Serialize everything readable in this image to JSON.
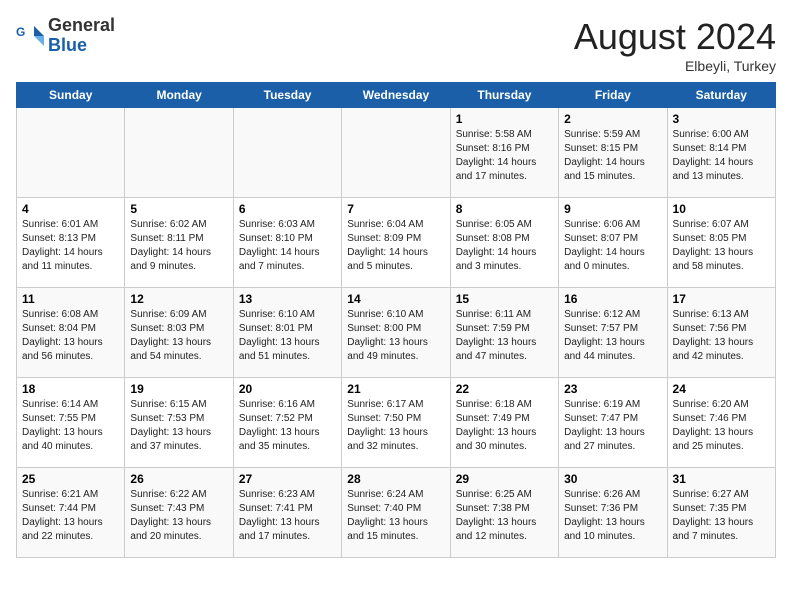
{
  "header": {
    "logo_line1": "General",
    "logo_line2": "Blue",
    "month_title": "August 2024",
    "location": "Elbeyli, Turkey"
  },
  "weekdays": [
    "Sunday",
    "Monday",
    "Tuesday",
    "Wednesday",
    "Thursday",
    "Friday",
    "Saturday"
  ],
  "weeks": [
    [
      {
        "day": "",
        "info": ""
      },
      {
        "day": "",
        "info": ""
      },
      {
        "day": "",
        "info": ""
      },
      {
        "day": "",
        "info": ""
      },
      {
        "day": "1",
        "info": "Sunrise: 5:58 AM\nSunset: 8:16 PM\nDaylight: 14 hours\nand 17 minutes."
      },
      {
        "day": "2",
        "info": "Sunrise: 5:59 AM\nSunset: 8:15 PM\nDaylight: 14 hours\nand 15 minutes."
      },
      {
        "day": "3",
        "info": "Sunrise: 6:00 AM\nSunset: 8:14 PM\nDaylight: 14 hours\nand 13 minutes."
      }
    ],
    [
      {
        "day": "4",
        "info": "Sunrise: 6:01 AM\nSunset: 8:13 PM\nDaylight: 14 hours\nand 11 minutes."
      },
      {
        "day": "5",
        "info": "Sunrise: 6:02 AM\nSunset: 8:11 PM\nDaylight: 14 hours\nand 9 minutes."
      },
      {
        "day": "6",
        "info": "Sunrise: 6:03 AM\nSunset: 8:10 PM\nDaylight: 14 hours\nand 7 minutes."
      },
      {
        "day": "7",
        "info": "Sunrise: 6:04 AM\nSunset: 8:09 PM\nDaylight: 14 hours\nand 5 minutes."
      },
      {
        "day": "8",
        "info": "Sunrise: 6:05 AM\nSunset: 8:08 PM\nDaylight: 14 hours\nand 3 minutes."
      },
      {
        "day": "9",
        "info": "Sunrise: 6:06 AM\nSunset: 8:07 PM\nDaylight: 14 hours\nand 0 minutes."
      },
      {
        "day": "10",
        "info": "Sunrise: 6:07 AM\nSunset: 8:05 PM\nDaylight: 13 hours\nand 58 minutes."
      }
    ],
    [
      {
        "day": "11",
        "info": "Sunrise: 6:08 AM\nSunset: 8:04 PM\nDaylight: 13 hours\nand 56 minutes."
      },
      {
        "day": "12",
        "info": "Sunrise: 6:09 AM\nSunset: 8:03 PM\nDaylight: 13 hours\nand 54 minutes."
      },
      {
        "day": "13",
        "info": "Sunrise: 6:10 AM\nSunset: 8:01 PM\nDaylight: 13 hours\nand 51 minutes."
      },
      {
        "day": "14",
        "info": "Sunrise: 6:10 AM\nSunset: 8:00 PM\nDaylight: 13 hours\nand 49 minutes."
      },
      {
        "day": "15",
        "info": "Sunrise: 6:11 AM\nSunset: 7:59 PM\nDaylight: 13 hours\nand 47 minutes."
      },
      {
        "day": "16",
        "info": "Sunrise: 6:12 AM\nSunset: 7:57 PM\nDaylight: 13 hours\nand 44 minutes."
      },
      {
        "day": "17",
        "info": "Sunrise: 6:13 AM\nSunset: 7:56 PM\nDaylight: 13 hours\nand 42 minutes."
      }
    ],
    [
      {
        "day": "18",
        "info": "Sunrise: 6:14 AM\nSunset: 7:55 PM\nDaylight: 13 hours\nand 40 minutes."
      },
      {
        "day": "19",
        "info": "Sunrise: 6:15 AM\nSunset: 7:53 PM\nDaylight: 13 hours\nand 37 minutes."
      },
      {
        "day": "20",
        "info": "Sunrise: 6:16 AM\nSunset: 7:52 PM\nDaylight: 13 hours\nand 35 minutes."
      },
      {
        "day": "21",
        "info": "Sunrise: 6:17 AM\nSunset: 7:50 PM\nDaylight: 13 hours\nand 32 minutes."
      },
      {
        "day": "22",
        "info": "Sunrise: 6:18 AM\nSunset: 7:49 PM\nDaylight: 13 hours\nand 30 minutes."
      },
      {
        "day": "23",
        "info": "Sunrise: 6:19 AM\nSunset: 7:47 PM\nDaylight: 13 hours\nand 27 minutes."
      },
      {
        "day": "24",
        "info": "Sunrise: 6:20 AM\nSunset: 7:46 PM\nDaylight: 13 hours\nand 25 minutes."
      }
    ],
    [
      {
        "day": "25",
        "info": "Sunrise: 6:21 AM\nSunset: 7:44 PM\nDaylight: 13 hours\nand 22 minutes."
      },
      {
        "day": "26",
        "info": "Sunrise: 6:22 AM\nSunset: 7:43 PM\nDaylight: 13 hours\nand 20 minutes."
      },
      {
        "day": "27",
        "info": "Sunrise: 6:23 AM\nSunset: 7:41 PM\nDaylight: 13 hours\nand 17 minutes."
      },
      {
        "day": "28",
        "info": "Sunrise: 6:24 AM\nSunset: 7:40 PM\nDaylight: 13 hours\nand 15 minutes."
      },
      {
        "day": "29",
        "info": "Sunrise: 6:25 AM\nSunset: 7:38 PM\nDaylight: 13 hours\nand 12 minutes."
      },
      {
        "day": "30",
        "info": "Sunrise: 6:26 AM\nSunset: 7:36 PM\nDaylight: 13 hours\nand 10 minutes."
      },
      {
        "day": "31",
        "info": "Sunrise: 6:27 AM\nSunset: 7:35 PM\nDaylight: 13 hours\nand 7 minutes."
      }
    ]
  ]
}
